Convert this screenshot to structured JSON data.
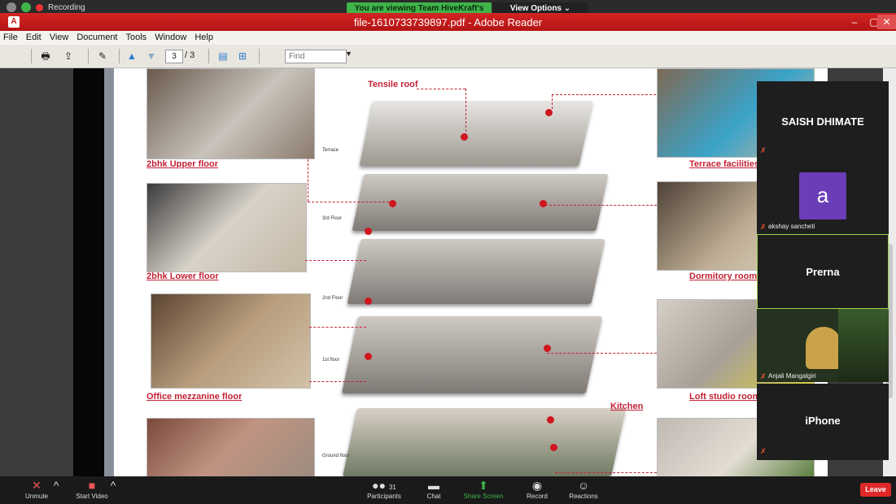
{
  "zoom": {
    "recording_label": "Recording",
    "share_banner": "You are viewing Team HiveKraft's screen",
    "view_options": "View Options ⌄"
  },
  "reader": {
    "title": "file-1610733739897.pdf - Adobe Reader",
    "menu": [
      "File",
      "Edit",
      "View",
      "Document",
      "Tools",
      "Window",
      "Help"
    ],
    "toolbar": {
      "current_page": "3",
      "page_total": "/ 3",
      "find_placeholder": "Find"
    }
  },
  "document": {
    "captions": {
      "upper_floor": "2bhk Upper floor",
      "lower_floor": "2bhk Lower floor",
      "office": "Office mezzanine floor",
      "terrace_facilities": "Terrace facilities",
      "dormitory": "Dormitory room",
      "loft": "Loft studio room",
      "kitchen": "Kitchen",
      "tensile_roof": "Tensile roof"
    },
    "floor_labels": {
      "terrace": "Terrace",
      "third": "3rd Floor",
      "second": "2nd Floor",
      "first": "1st floor",
      "ground": "Ground floor"
    }
  },
  "participants": [
    {
      "name": "SAISH DHIMATE"
    },
    {
      "name": "akshay sancheti",
      "avatar_letter": "a"
    },
    {
      "name": "Prerna"
    },
    {
      "name": "Anjali Mangalgiri"
    },
    {
      "name": "iPhone"
    }
  ],
  "bottom_bar": {
    "unmute": "Unmute",
    "start_video": "Start Video",
    "participants": "Participants",
    "participants_count": "31",
    "chat": "Chat",
    "share_screen": "Share Screen",
    "record": "Record",
    "reactions": "Reactions",
    "leave": "Leave"
  },
  "colors": {
    "adobe_red": "#c41a1a",
    "share_green": "#3fb44a",
    "caption_red": "#c32236",
    "leave_red": "#e02828",
    "avatar_purple": "#6b3db8"
  }
}
